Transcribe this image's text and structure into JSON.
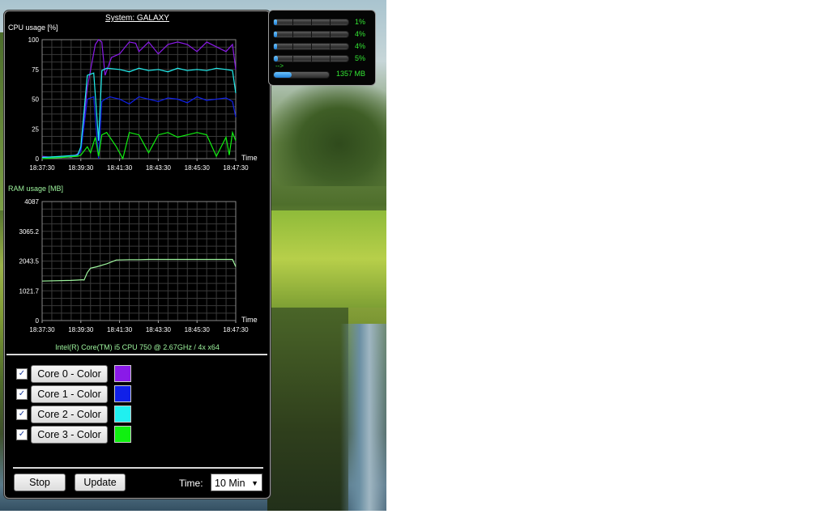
{
  "desktop": {
    "wallpaper": "river meadow landscape"
  },
  "gadget": {
    "title": "System: GALAXY",
    "cpu_info": "Intel(R) Core(TM) i5 CPU 750 @ 2.67GHz / 4x x64",
    "cores": [
      {
        "checked": "✓",
        "label": "Core 0 - Color",
        "color": "#8a1ae8"
      },
      {
        "checked": "✓",
        "label": "Core 1 - Color",
        "color": "#1020e8"
      },
      {
        "checked": "✓",
        "label": "Core 2 - Color",
        "color": "#20f0f0"
      },
      {
        "checked": "✓",
        "label": "Core 3 - Color",
        "color": "#10f010"
      }
    ],
    "stop_label": "Stop",
    "update_label": "Update",
    "time_label": "Time:",
    "time_value": "10 Min"
  },
  "mini": {
    "cores": [
      {
        "value_text": "1%",
        "fraction": 0.01
      },
      {
        "value_text": "4%",
        "fraction": 0.04
      },
      {
        "value_text": "4%",
        "fraction": 0.04
      },
      {
        "value_text": "5%",
        "fraction": 0.05
      }
    ],
    "arrow": "-->",
    "ram_text": "1357 MB",
    "ram_fraction": 0.33
  },
  "chart_data": [
    {
      "type": "line",
      "title": "CPU usage [%]",
      "xlabel": "Time",
      "ylabel": "",
      "x_ticks": [
        "18:37:30",
        "18:39:30",
        "18:41:30",
        "18:43:30",
        "18:45:30",
        "18:47:30"
      ],
      "y_ticks": [
        "0",
        "25",
        "50",
        "75",
        "100"
      ],
      "ylim": [
        0,
        100
      ],
      "xlim": [
        0,
        600
      ],
      "grid": true,
      "series": [
        {
          "color": "#8a1ae8",
          "x": [
            0,
            30,
            60,
            90,
            110,
            120,
            140,
            165,
            175,
            185,
            195,
            215,
            240,
            270,
            290,
            300,
            330,
            360,
            390,
            420,
            450,
            480,
            510,
            540,
            570,
            590,
            600
          ],
          "y": [
            2,
            1,
            2,
            1,
            4,
            8,
            60,
            96,
            100,
            98,
            70,
            85,
            88,
            98,
            97,
            90,
            98,
            88,
            96,
            98,
            96,
            90,
            98,
            94,
            90,
            96,
            75
          ]
        },
        {
          "color": "#1020e8",
          "x": [
            0,
            60,
            110,
            120,
            140,
            160,
            175,
            185,
            195,
            210,
            240,
            270,
            300,
            330,
            360,
            390,
            420,
            450,
            480,
            510,
            540,
            570,
            590,
            600
          ],
          "y": [
            1,
            1,
            3,
            6,
            50,
            52,
            0,
            48,
            50,
            52,
            50,
            46,
            52,
            50,
            48,
            51,
            50,
            47,
            52,
            49,
            50,
            51,
            48,
            35
          ]
        },
        {
          "color": "#20f0f0",
          "x": [
            0,
            60,
            110,
            120,
            140,
            160,
            175,
            185,
            200,
            240,
            270,
            300,
            330,
            360,
            390,
            420,
            450,
            480,
            510,
            540,
            570,
            590,
            600
          ],
          "y": [
            1,
            2,
            3,
            10,
            70,
            72,
            15,
            74,
            76,
            75,
            73,
            76,
            74,
            75,
            73,
            76,
            74,
            75,
            74,
            76,
            75,
            74,
            55
          ]
        },
        {
          "color": "#10f010",
          "x": [
            0,
            60,
            110,
            120,
            140,
            150,
            165,
            175,
            185,
            200,
            230,
            250,
            270,
            300,
            330,
            360,
            390,
            420,
            450,
            480,
            510,
            540,
            570,
            580,
            590,
            600
          ],
          "y": [
            0,
            1,
            2,
            3,
            10,
            5,
            18,
            2,
            20,
            22,
            10,
            0,
            22,
            20,
            5,
            20,
            22,
            18,
            20,
            22,
            20,
            2,
            18,
            3,
            22,
            15
          ]
        }
      ]
    },
    {
      "type": "line",
      "title": "RAM usage [MB]",
      "xlabel": "Time",
      "ylabel": "",
      "x_ticks": [
        "18:37:30",
        "18:39:30",
        "18:41:30",
        "18:43:30",
        "18:45:30",
        "18:47:30"
      ],
      "y_ticks": [
        "0",
        "1021.7",
        "2043.5",
        "3065.2",
        "4087"
      ],
      "ylim": [
        0,
        4087
      ],
      "xlim": [
        0,
        600
      ],
      "grid": true,
      "series": [
        {
          "color": "#9ef59e",
          "x": [
            0,
            90,
            110,
            125,
            130,
            140,
            150,
            170,
            200,
            230,
            270,
            300,
            330,
            360,
            400,
            430,
            470,
            500,
            540,
            570,
            590,
            600
          ],
          "y": [
            1357,
            1380,
            1390,
            1400,
            1390,
            1650,
            1800,
            1850,
            1950,
            2080,
            2090,
            2090,
            2100,
            2100,
            2100,
            2100,
            2100,
            2100,
            2100,
            2100,
            2100,
            1850
          ]
        }
      ]
    }
  ]
}
